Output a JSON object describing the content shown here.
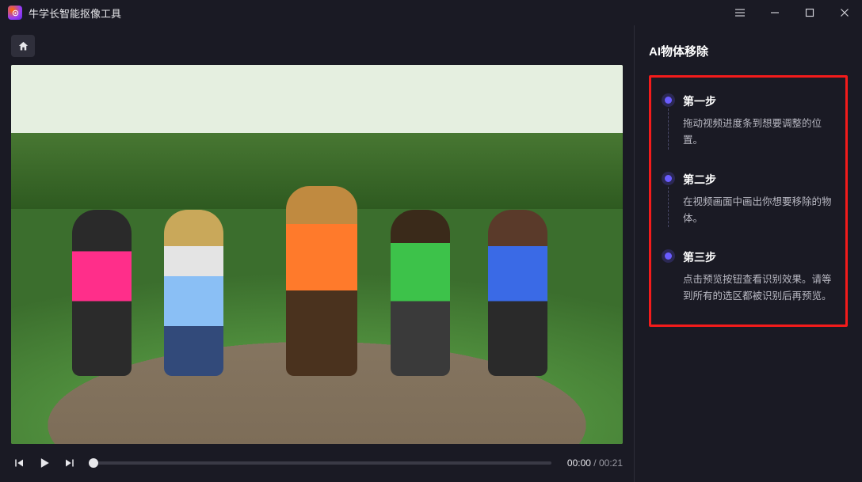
{
  "app": {
    "title": "牛学长智能抠像工具"
  },
  "player": {
    "current_time": "00:00",
    "total_time": "00:21"
  },
  "sidebar": {
    "title": "AI物体移除",
    "steps": [
      {
        "title": "第一步",
        "desc": "拖动视频进度条到想要调整的位置。"
      },
      {
        "title": "第二步",
        "desc": "在视频画面中画出你想要移除的物体。"
      },
      {
        "title": "第三步",
        "desc": "点击预览按钮查看识别效果。请等到所有的选区都被识别后再预览。"
      }
    ]
  }
}
